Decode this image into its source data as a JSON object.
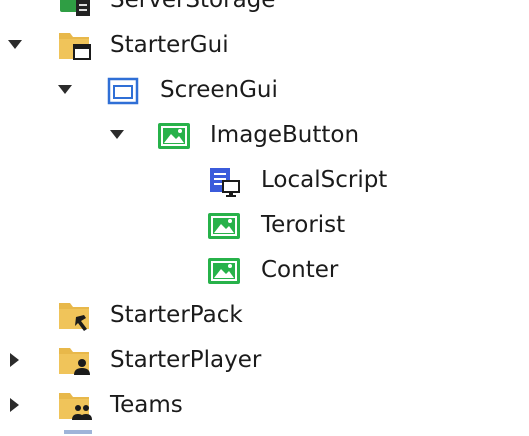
{
  "explorer": {
    "items": [
      {
        "label": "ServerStorage",
        "icon": "server-storage-icon",
        "expanded": null
      },
      {
        "label": "StarterGui",
        "icon": "starter-gui-folder-icon",
        "expanded": true
      },
      {
        "label": "ScreenGui",
        "icon": "screen-gui-icon",
        "expanded": true
      },
      {
        "label": "ImageButton",
        "icon": "image-button-icon",
        "expanded": true
      },
      {
        "label": "LocalScript",
        "icon": "local-script-icon",
        "expanded": null
      },
      {
        "label": "Terorist",
        "icon": "image-button-icon",
        "expanded": null
      },
      {
        "label": "Conter",
        "icon": "image-button-icon",
        "expanded": null
      },
      {
        "label": "StarterPack",
        "icon": "starter-pack-folder-icon",
        "expanded": null
      },
      {
        "label": "StarterPlayer",
        "icon": "starter-player-folder-icon",
        "expanded": false
      },
      {
        "label": "Teams",
        "icon": "teams-folder-icon",
        "expanded": false
      }
    ]
  },
  "colors": {
    "folder": "#e8b84a",
    "image_button": "#27b24a",
    "screen_gui": "#2f6fd6",
    "script": "#3b5bdb"
  }
}
